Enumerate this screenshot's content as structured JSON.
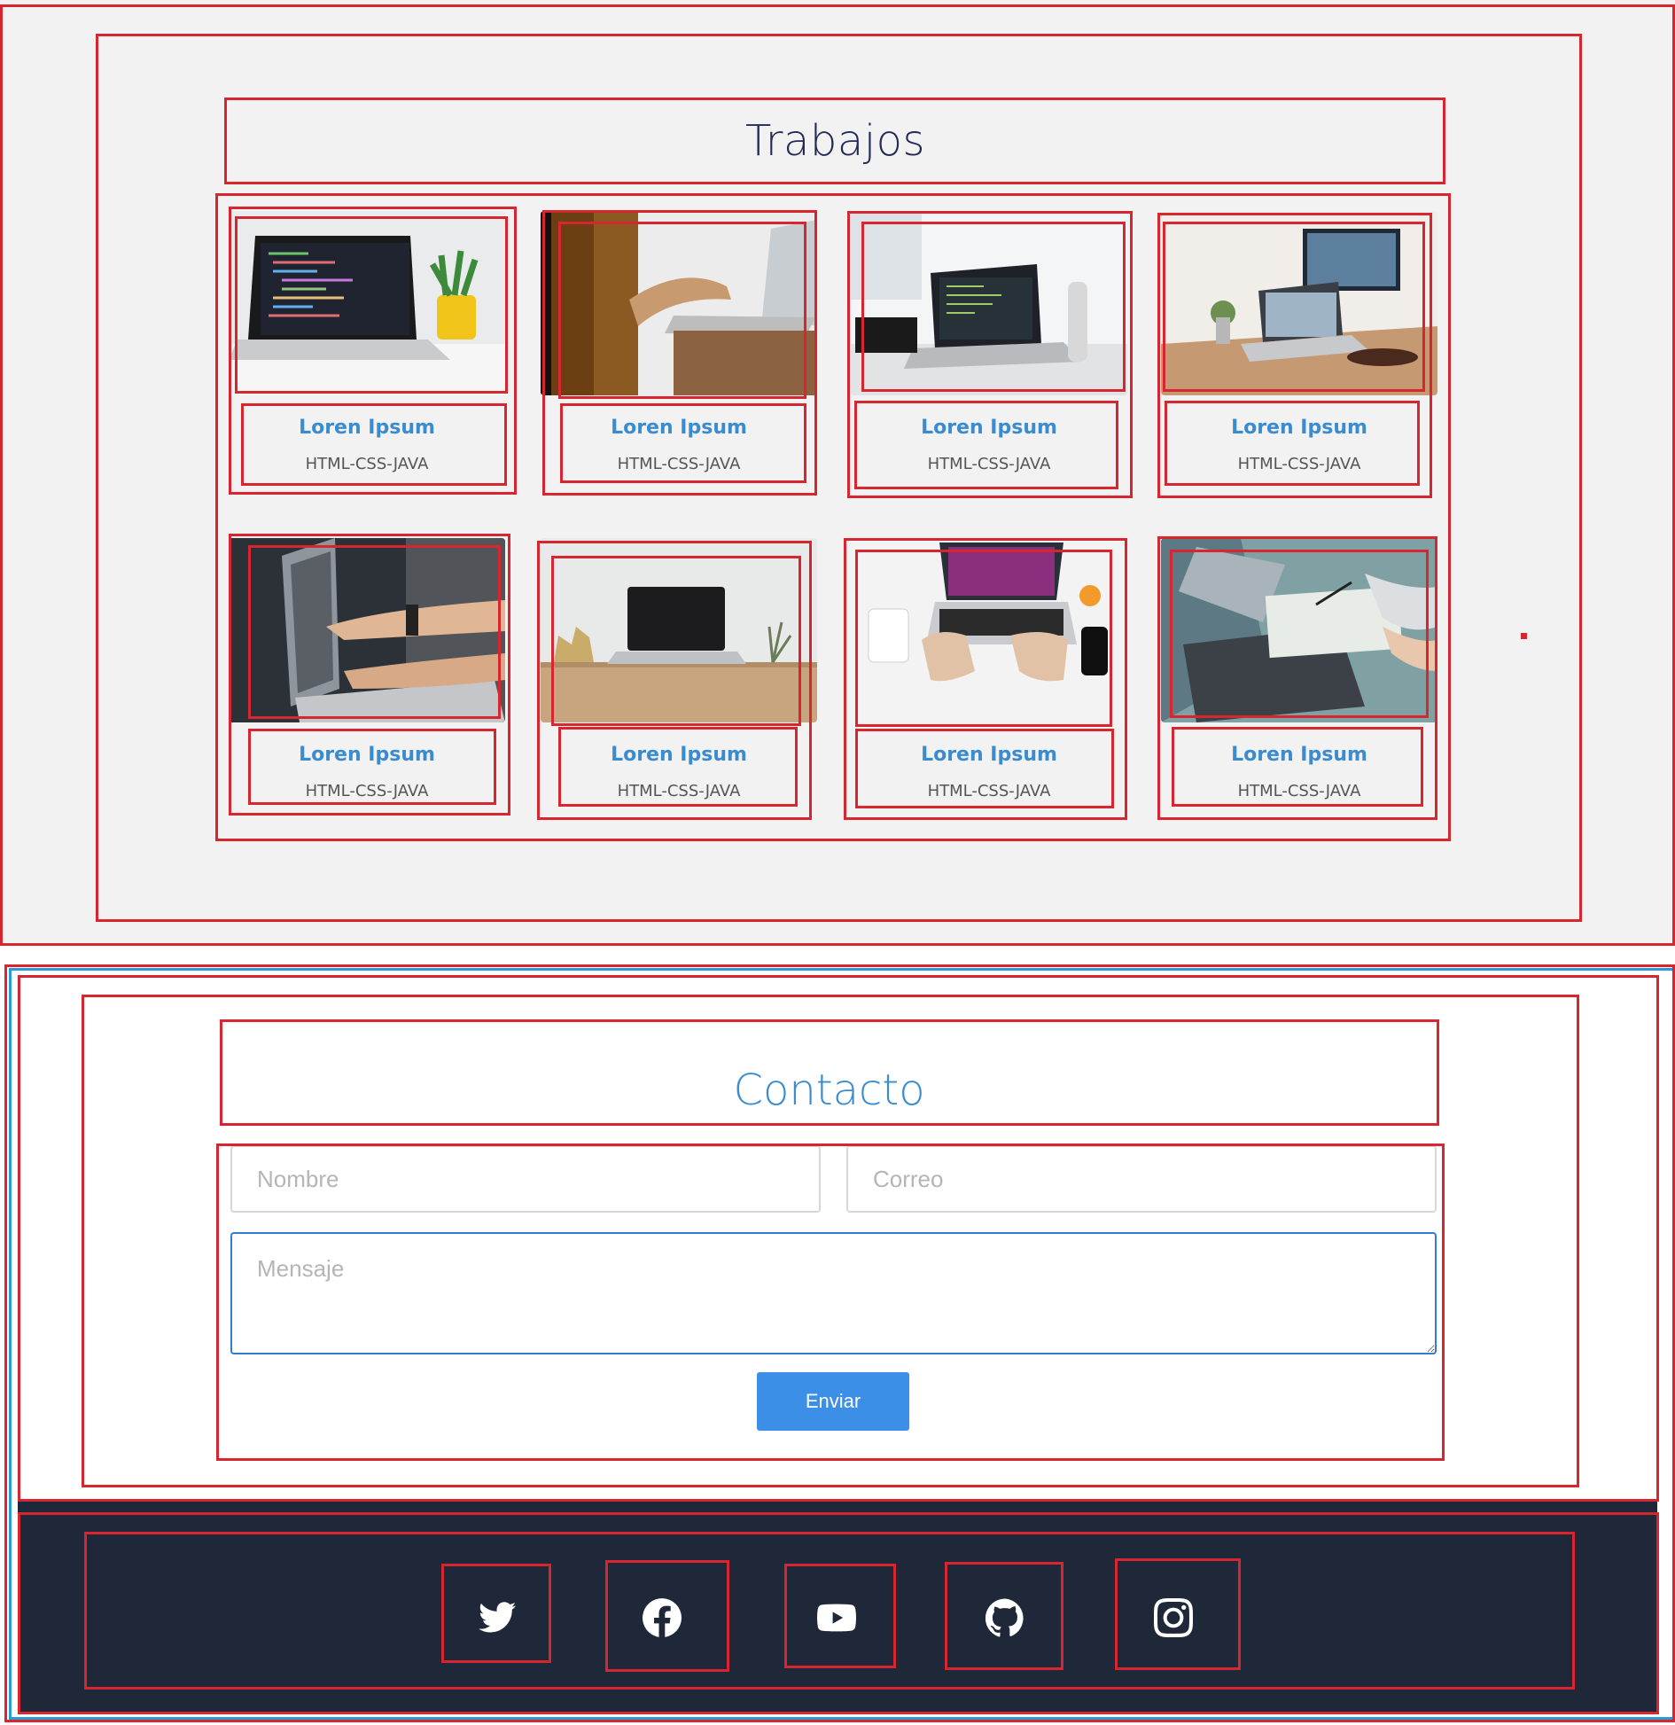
{
  "trabajos": {
    "title": "Trabajos",
    "cards": [
      {
        "title": "Loren Ipsum",
        "tech": "HTML-CSS-JAVA"
      },
      {
        "title": "Loren Ipsum",
        "tech": "HTML-CSS-JAVA"
      },
      {
        "title": "Loren Ipsum",
        "tech": "HTML-CSS-JAVA"
      },
      {
        "title": "Loren Ipsum",
        "tech": "HTML-CSS-JAVA"
      },
      {
        "title": "Loren Ipsum",
        "tech": "HTML-CSS-JAVA"
      },
      {
        "title": "Loren Ipsum",
        "tech": "HTML-CSS-JAVA"
      },
      {
        "title": "Loren Ipsum",
        "tech": "HTML-CSS-JAVA"
      },
      {
        "title": "Loren Ipsum",
        "tech": "HTML-CSS-JAVA"
      }
    ]
  },
  "contacto": {
    "title": "Contacto",
    "nombre_placeholder": "Nombre",
    "correo_placeholder": "Correo",
    "mensaje_placeholder": "Mensaje",
    "send_label": "Enviar"
  },
  "footer": {
    "icons": [
      "twitter-icon",
      "facebook-icon",
      "youtube-icon",
      "github-icon",
      "instagram-icon"
    ]
  },
  "colors": {
    "accent": "#3b8ccf",
    "button": "#3b8fe6",
    "footer_bg": "#1f2838",
    "heading_dark": "#232a55"
  }
}
